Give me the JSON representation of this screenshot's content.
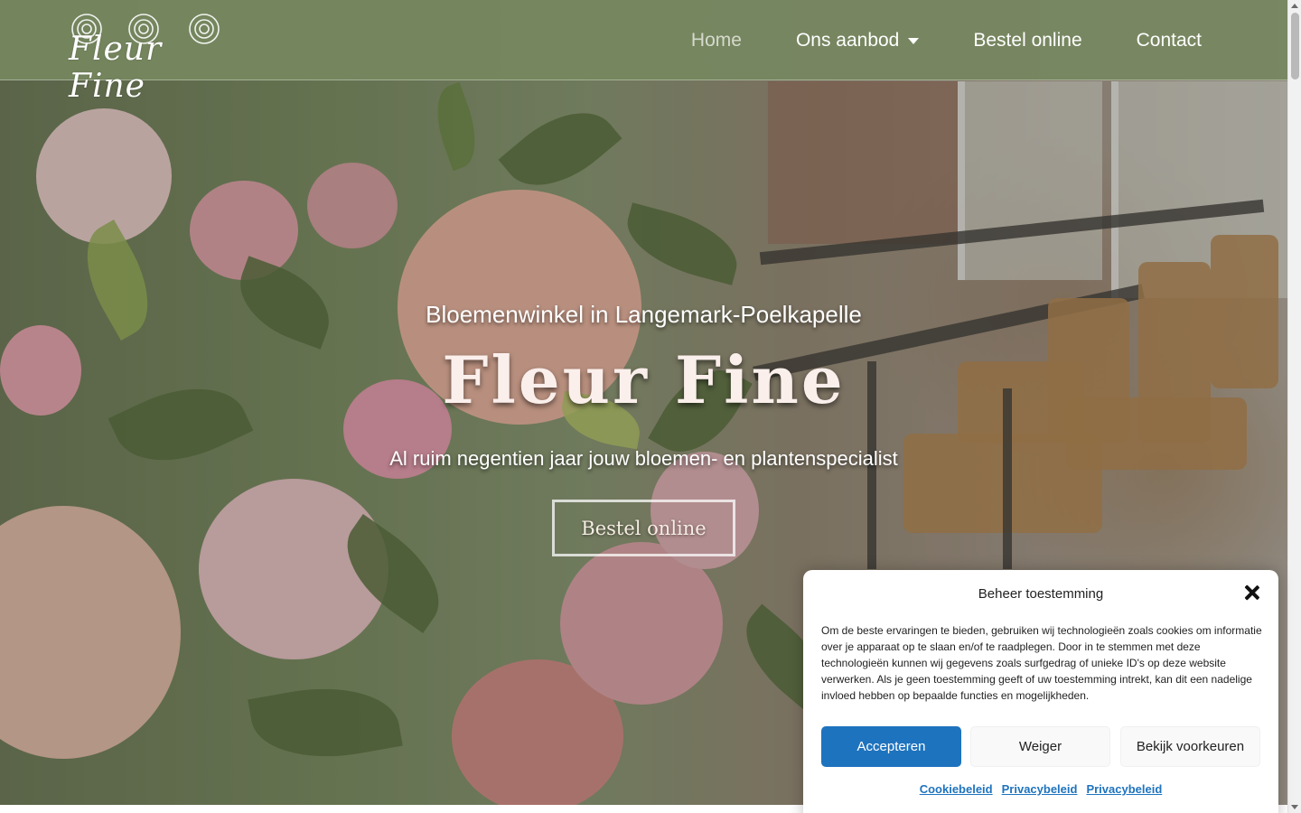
{
  "header": {
    "logo_text": "Fleur Fine",
    "nav": [
      {
        "label": "Home",
        "active": true
      },
      {
        "label": "Ons aanbod",
        "has_dropdown": true
      },
      {
        "label": "Bestel online"
      },
      {
        "label": "Contact"
      }
    ]
  },
  "hero": {
    "subtitle": "Bloemenwinkel in Langemark-Poelkapelle",
    "title": "Fleur Fine",
    "tagline": "Al ruim negentien jaar jouw bloemen- en plantenspecialist",
    "cta_label": "Bestel online"
  },
  "cookie": {
    "title": "Beheer toestemming",
    "body": "Om de beste ervaringen te bieden, gebruiken wij technologieën zoals cookies om informatie over je apparaat op te slaan en/of te raadplegen. Door in te stemmen met deze technologieën kunnen wij gegevens zoals surfgedrag of unieke ID's op deze website verwerken. Als je geen toestemming geeft of uw toestemming intrekt, kan dit een nadelige invloed hebben op bepaalde functies en mogelijkheden.",
    "accept_label": "Accepteren",
    "deny_label": "Weiger",
    "prefs_label": "Bekijk voorkeuren",
    "links": [
      "Cookiebeleid",
      "Privacybeleid",
      "Privacybeleid"
    ]
  },
  "colors": {
    "header_bg": "#768860",
    "accent_blue": "#1e73be",
    "title_color": "#fbefec"
  },
  "icons": {
    "close": "close-icon",
    "dropdown": "chevron-down-icon",
    "logo_flowers": "flower-icon"
  }
}
